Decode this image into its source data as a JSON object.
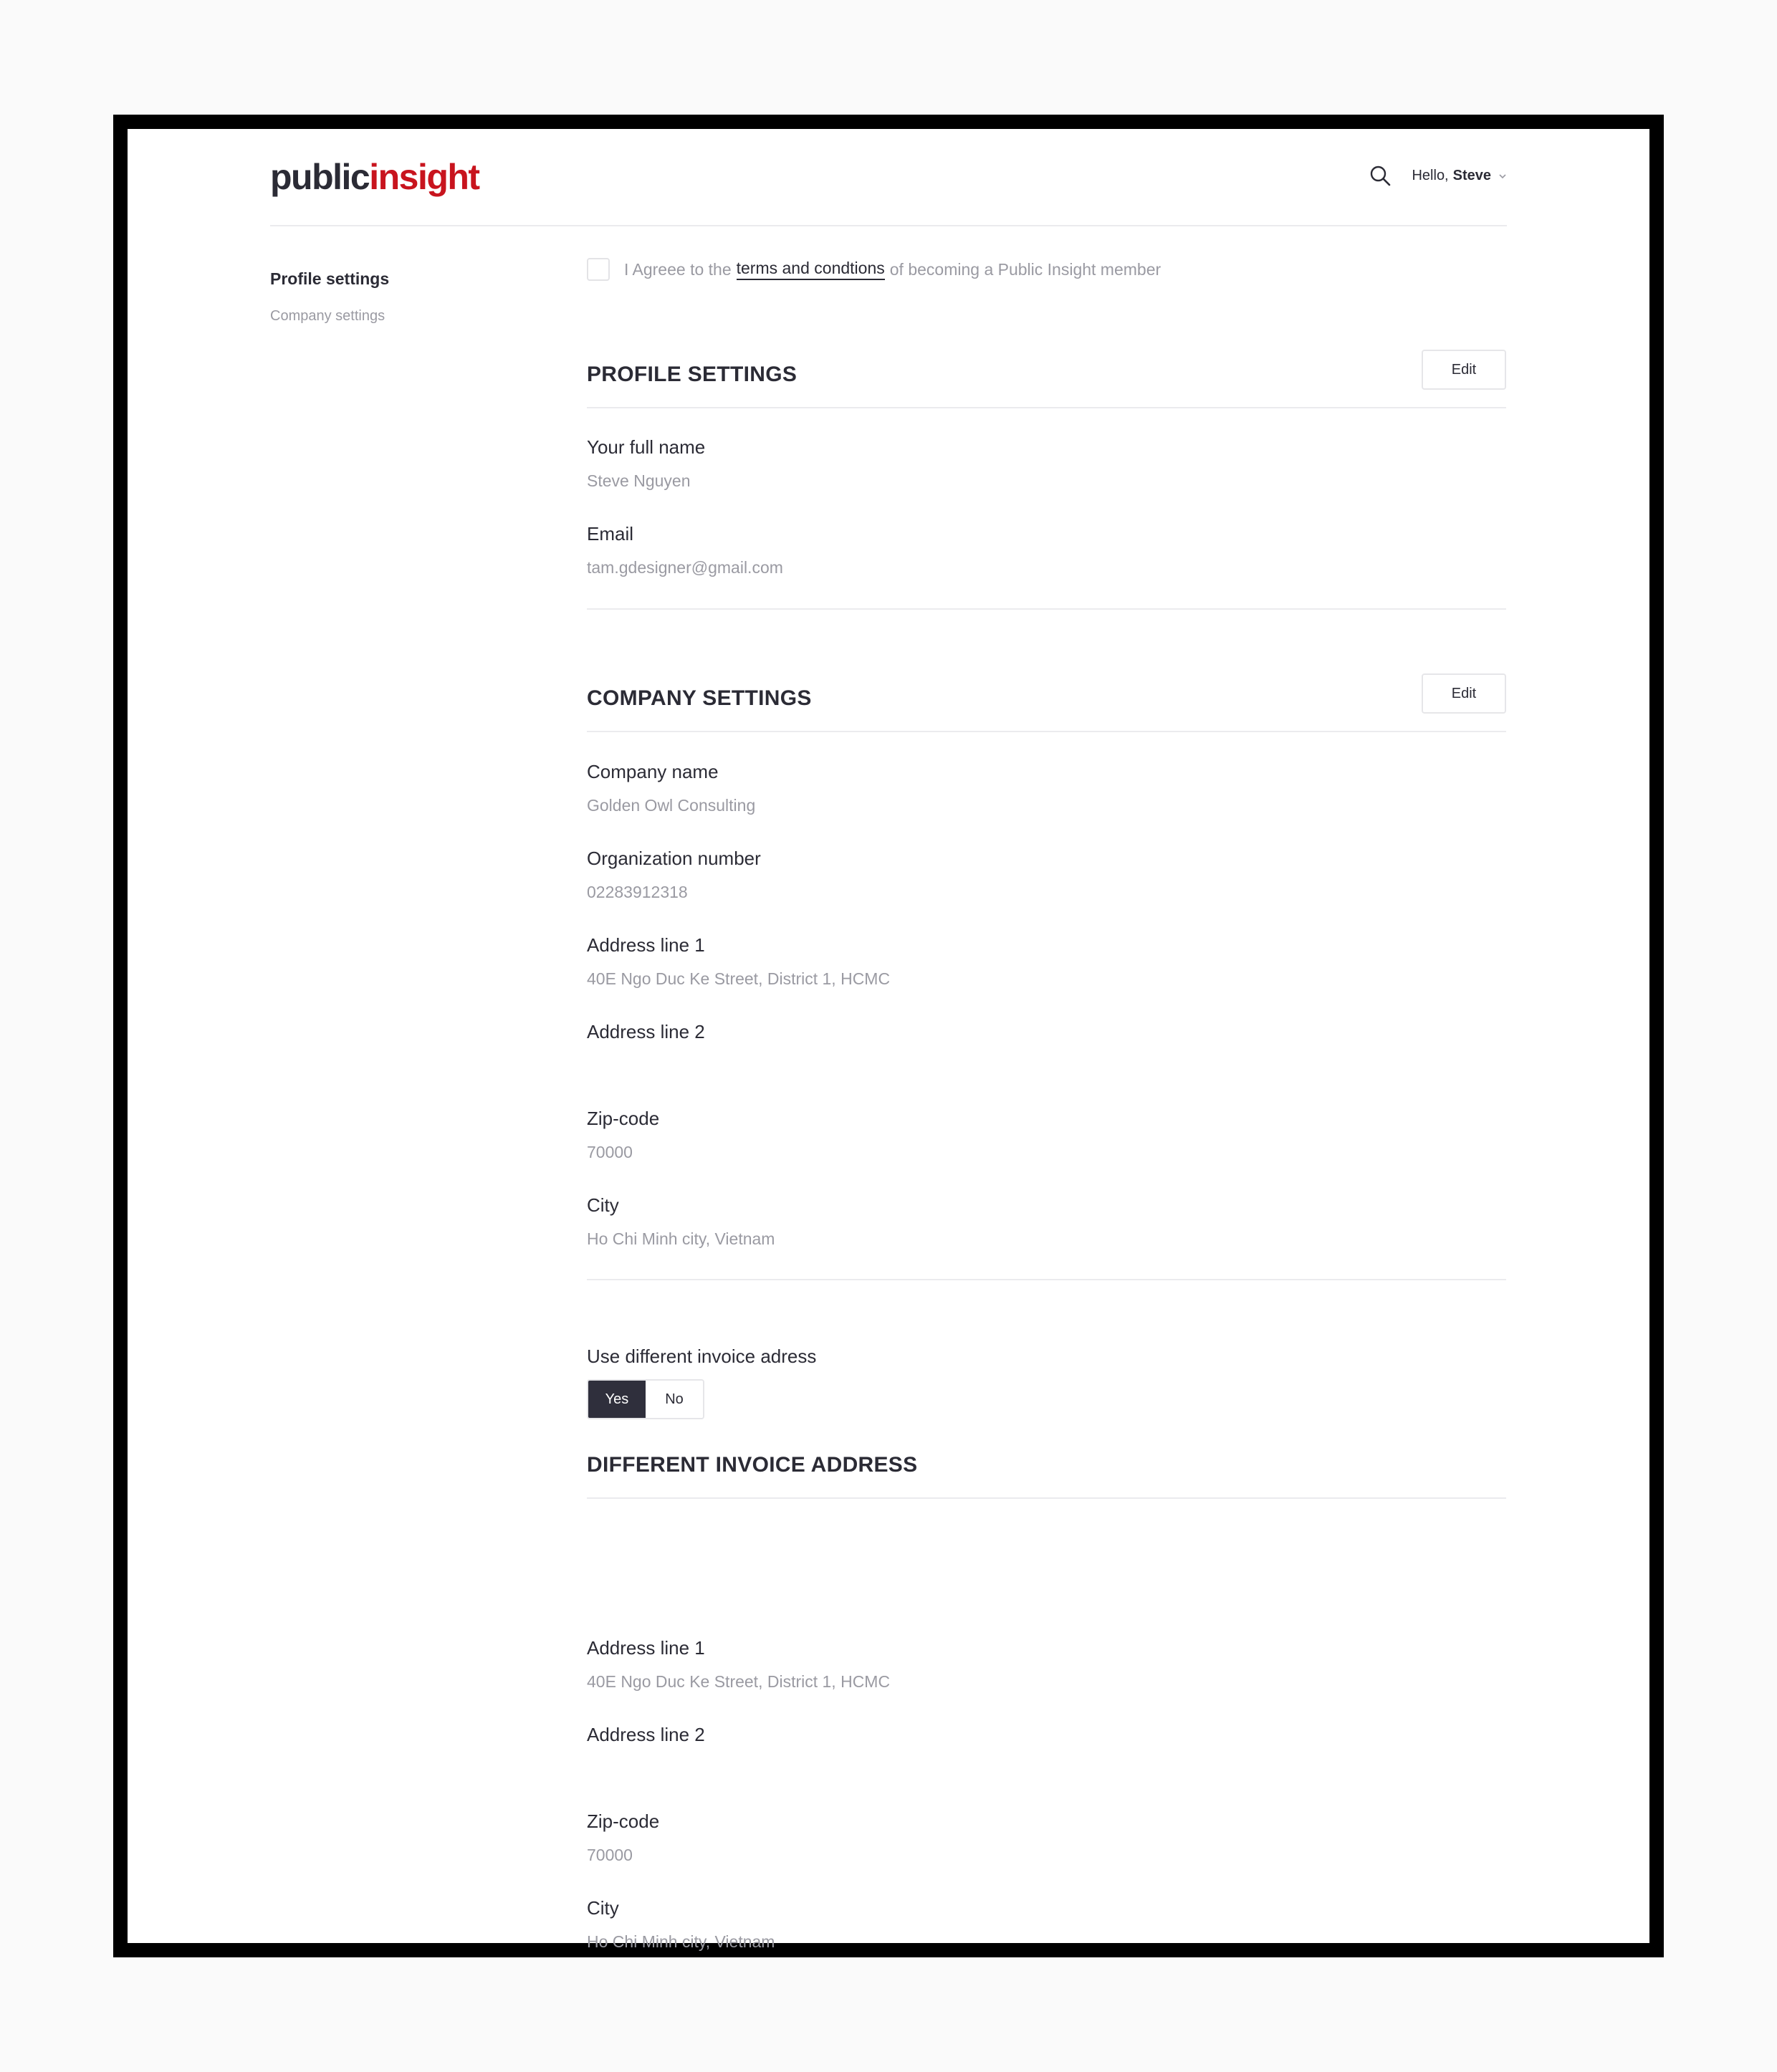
{
  "header": {
    "logo_part1": "public",
    "logo_part2": "insight",
    "greeting": "Hello,",
    "user_name": "Steve"
  },
  "sidebar": {
    "items": [
      {
        "label": "Profile settings"
      },
      {
        "label": "Company settings"
      }
    ]
  },
  "agreement": {
    "text_before": "I Agreee to the",
    "link_text": "terms and condtions",
    "text_after": "of becoming a Public Insight member"
  },
  "profile": {
    "title": "PROFILE SETTINGS",
    "edit_label": "Edit",
    "fields": [
      {
        "label": "Your full name",
        "value": "Steve Nguyen"
      },
      {
        "label": "Email",
        "value": "tam.gdesigner@gmail.com"
      }
    ]
  },
  "company": {
    "title": "COMPANY SETTINGS",
    "edit_label": "Edit",
    "fields": [
      {
        "label": "Company name",
        "value": "Golden Owl Consulting"
      },
      {
        "label": "Organization number",
        "value": "02283912318"
      },
      {
        "label": "Address line 1",
        "value": "40E Ngo Duc Ke Street, District 1, HCMC"
      },
      {
        "label": "Address line 2",
        "value": ""
      },
      {
        "label": "Zip-code",
        "value": "70000"
      },
      {
        "label": "City",
        "value": "Ho Chi Minh city, Vietnam"
      }
    ]
  },
  "invoice_toggle": {
    "label": "Use different invoice adress",
    "yes_label": "Yes",
    "no_label": "No",
    "selected": "Yes"
  },
  "invoice": {
    "title": "DIFFERENT INVOICE ADDRESS",
    "fields": [
      {
        "label": "Address line 1",
        "value": "40E Ngo Duc Ke Street, District 1, HCMC"
      },
      {
        "label": "Address line 2",
        "value": ""
      },
      {
        "label": "Zip-code",
        "value": "70000"
      },
      {
        "label": "City",
        "value": "Ho Chi Minh city, Vietnam"
      }
    ]
  },
  "colors": {
    "brand_red": "#c8141e",
    "text_dark": "#2b2b35",
    "text_muted": "#9a9aa2",
    "toggle_active": "#2f2f3c"
  }
}
